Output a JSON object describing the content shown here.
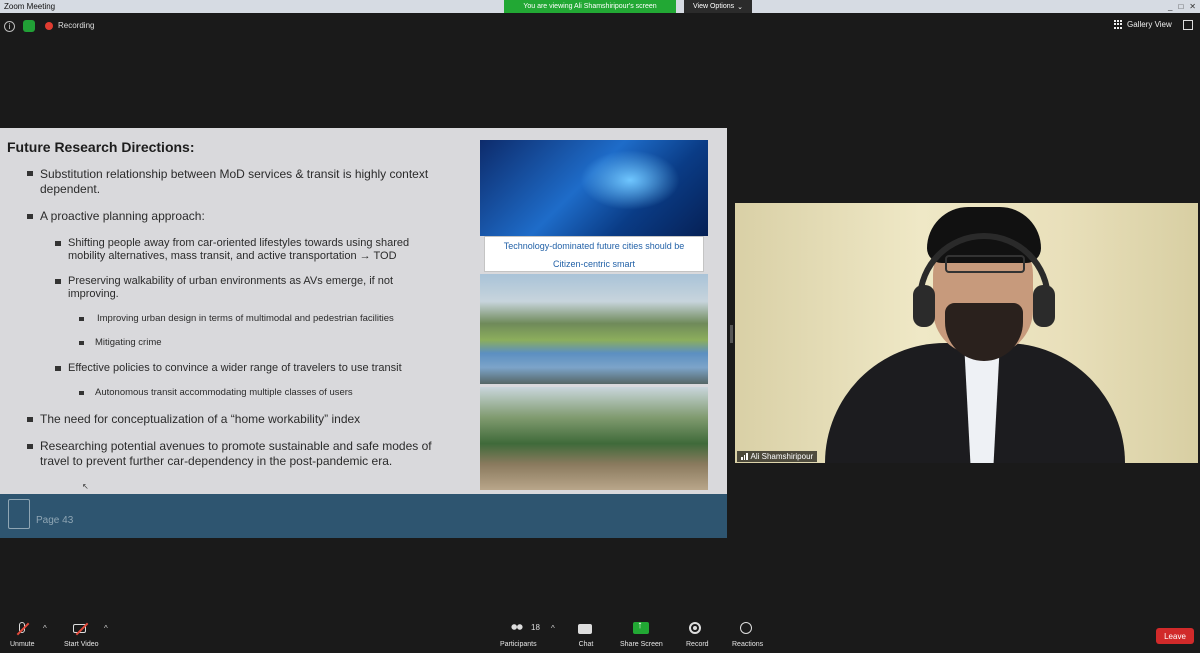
{
  "window": {
    "title": "Zoom Meeting",
    "controls": [
      "_",
      "□",
      "✕"
    ]
  },
  "banner": {
    "viewing": "You are viewing Ali Shamshiripour's screen",
    "view_options": "View Options",
    "view_options_caret": "⌄"
  },
  "status": {
    "recording": "Recording",
    "gallery_view": "Gallery View",
    "info_glyph": "i"
  },
  "slide": {
    "title": "Future Research Directions:",
    "bullets": [
      {
        "level": 1,
        "text": "Substitution relationship between MoD services & transit is highly context"
      },
      {
        "level": 1,
        "text": "dependent."
      },
      {
        "level": 1,
        "text": "A proactive planning approach:"
      },
      {
        "level": 2,
        "text": "Shifting people away from car-oriented lifestyles towards using shared"
      },
      {
        "level": 2,
        "text": "mobility alternatives, mass transit, and active transportation → TOD"
      },
      {
        "level": 2,
        "text": "Preserving walkability of urban environments as AVs emerge, if not"
      },
      {
        "level": 2,
        "text": "improving."
      },
      {
        "level": 3,
        "text": "Improving urban design in terms of multimodal and pedestrian facilities"
      },
      {
        "level": 3,
        "text": "Mitigating crime"
      },
      {
        "level": 2,
        "text": "Effective policies to convince a wider range of travelers to use transit"
      },
      {
        "level": 3,
        "text": "Autonomous transit accommodating multiple classes of users"
      },
      {
        "level": 1,
        "text": "The need for conceptualization of a “home workability” index"
      },
      {
        "level": 1,
        "text": "Researching potential avenues to promote sustainable and safe modes of"
      },
      {
        "level": 1,
        "text": "travel to prevent further car-dependency in the post-pandemic era."
      }
    ],
    "caption_line1": "Technology-dominated future cities should be",
    "caption_line2": "Citizen-centric smart",
    "page_label": "Page 43",
    "cursor_glyph": "↖"
  },
  "video": {
    "participant_name": "Ali Shamshiripour"
  },
  "toolbar": {
    "unmute": "Unmute",
    "start_video": "Start Video",
    "participants": "Participants",
    "participants_count": "18",
    "chat": "Chat",
    "share_screen": "Share Screen",
    "record": "Record",
    "reactions": "Reactions",
    "leave": "Leave",
    "caret": "^"
  },
  "colors": {
    "share_green": "#22a834",
    "leave_red": "#d12a2a",
    "slide_footer": "#2e5570"
  }
}
